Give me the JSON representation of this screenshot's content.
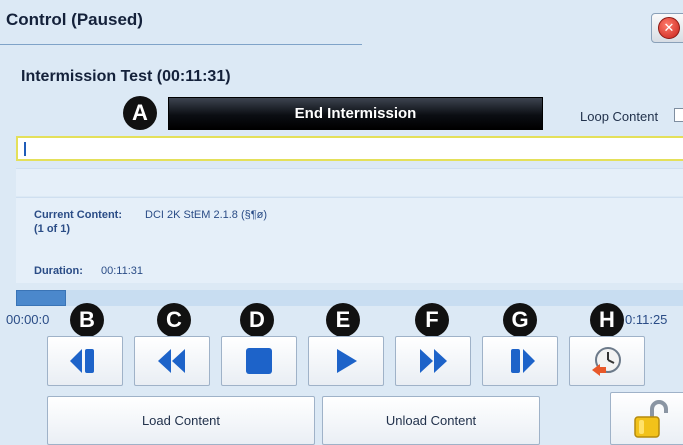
{
  "window": {
    "title": "Control (Paused)",
    "close_icon": "close-icon"
  },
  "content_title": "Intermission Test (00:11:31)",
  "markers": [
    "A",
    "B",
    "C",
    "D",
    "E",
    "F",
    "G",
    "H"
  ],
  "end_intermission_label": "End Intermission",
  "loop_content": {
    "label": "Loop Content",
    "checked": false
  },
  "info": {
    "current_content_label": "Current Content:",
    "current_content_value": "DCI 2K StEM 2.1.8 (§¶ø)",
    "count": "(1 of 1)",
    "duration_label": "Duration:",
    "duration_value": "00:11:31"
  },
  "playback": {
    "progress_fraction": 0.074,
    "time_start": "00:00:0",
    "time_end": "0:11:25"
  },
  "transport": [
    {
      "icon": "step-back-icon"
    },
    {
      "icon": "rewind-icon"
    },
    {
      "icon": "stop-icon"
    },
    {
      "icon": "play-icon"
    },
    {
      "icon": "fast-forward-icon"
    },
    {
      "icon": "step-forward-icon"
    },
    {
      "icon": "schedule-clock-icon"
    }
  ],
  "load_label": "Load Content",
  "unload_label": "Unload Content",
  "lock_icon": "unlocked-padlock-icon",
  "colors": {
    "background": "#dce9f5",
    "icon_blue": "#1d63c9",
    "field_border": "#e4e05a"
  }
}
